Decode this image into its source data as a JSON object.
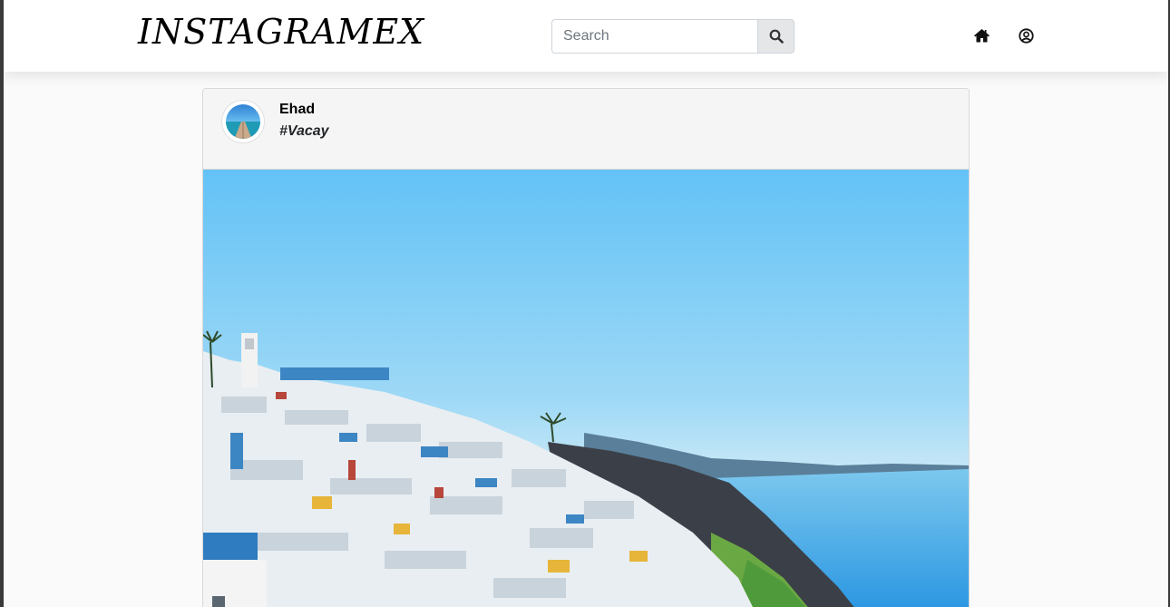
{
  "navbar": {
    "brand": "INSTAGRAMEX",
    "search": {
      "placeholder": "Search",
      "value": "",
      "button_icon": "search-icon"
    },
    "icons": [
      "home-icon",
      "user-circle-icon"
    ]
  },
  "post": {
    "username": "Ehad",
    "caption": "#Vacay",
    "avatar_icon": "beach-pier-avatar",
    "image": "santorini-coastline-photo"
  },
  "colors": {
    "navbar_bg": "#ffffff",
    "page_bg": "#fafafa",
    "card_header_bg": "#f5f5f5",
    "search_button_bg": "#e4e6e8"
  }
}
